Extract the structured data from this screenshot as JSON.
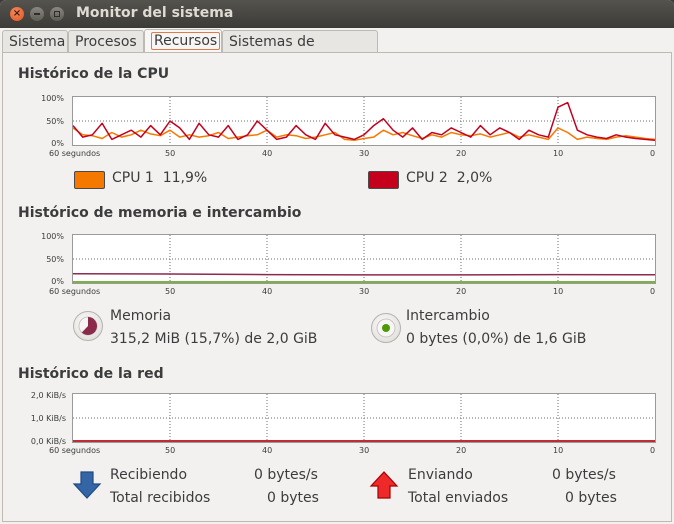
{
  "window": {
    "title": "Monitor del sistema",
    "buttons": {
      "close": "×"
    }
  },
  "tabs": [
    {
      "label": "Sistema",
      "active": false
    },
    {
      "label": "Procesos",
      "active": false
    },
    {
      "label": "Recursos",
      "active": true
    },
    {
      "label": "Sistemas de archivos",
      "active": false
    }
  ],
  "cpu": {
    "title": "Histórico de la CPU",
    "y_ticks": [
      "100%",
      "50%",
      "0%"
    ],
    "x_ticks": [
      "60 segundos",
      "50",
      "40",
      "30",
      "20",
      "10",
      "0"
    ],
    "legend": [
      {
        "label": "CPU 1",
        "value": "11,9%",
        "color": "#f57900"
      },
      {
        "label": "CPU 2",
        "value": "2,0%",
        "color": "#c4001d"
      }
    ]
  },
  "memory": {
    "title": "Histórico de memoria e intercambio",
    "y_ticks": [
      "100%",
      "50%",
      "0%"
    ],
    "x_ticks": [
      "60 segundos",
      "50",
      "40",
      "30",
      "20",
      "10",
      "0"
    ],
    "mem_label": "Memoria",
    "mem_value": "315,2 MiB (15,7%) de 2,0 GiB",
    "mem_color": "#8c2a4c",
    "swap_label": "Intercambio",
    "swap_value": "0 bytes (0,0%) de 1,6 GiB",
    "swap_color": "#4e9a06"
  },
  "network": {
    "title": "Histórico de la red",
    "y_ticks": [
      "2,0 KiB/s",
      "1,0 KiB/s",
      "0,0 KiB/s"
    ],
    "x_ticks": [
      "60 segundos",
      "50",
      "40",
      "30",
      "20",
      "10",
      "0"
    ],
    "recv_label": "Recibiendo",
    "recv_value": "0 bytes/s",
    "recv_total_label": "Total recibidos",
    "recv_total_value": "0 bytes",
    "send_label": "Enviando",
    "send_value": "0 bytes/s",
    "send_total_label": "Total enviados",
    "send_total_value": "0 bytes",
    "recv_color": "#3465a4",
    "send_color": "#cc0000"
  },
  "chart_data": [
    {
      "type": "line",
      "title": "Histórico de la CPU",
      "x": [
        60,
        59,
        58,
        57,
        56,
        55,
        54,
        53,
        52,
        51,
        50,
        49,
        48,
        47,
        46,
        45,
        44,
        43,
        42,
        41,
        40,
        39,
        38,
        37,
        36,
        35,
        34,
        33,
        32,
        31,
        30,
        29,
        28,
        27,
        26,
        25,
        24,
        23,
        22,
        21,
        20,
        19,
        18,
        17,
        16,
        15,
        14,
        13,
        12,
        11,
        10,
        9,
        8,
        7,
        6,
        5,
        4,
        3,
        2,
        1,
        0
      ],
      "ylim": [
        0,
        100
      ],
      "series": [
        {
          "name": "CPU 1",
          "values": [
            35,
            20,
            18,
            12,
            25,
            15,
            20,
            30,
            22,
            18,
            30,
            15,
            20,
            15,
            18,
            25,
            12,
            15,
            18,
            20,
            30,
            15,
            20,
            18,
            12,
            15,
            20,
            25,
            10,
            8,
            12,
            15,
            30,
            20,
            25,
            18,
            12,
            20,
            15,
            25,
            20,
            18,
            22,
            15,
            20,
            25,
            15,
            20,
            15,
            10,
            35,
            25,
            10,
            15,
            12,
            10,
            15,
            18,
            15,
            12,
            10
          ]
        },
        {
          "name": "CPU 2",
          "values": [
            40,
            15,
            20,
            45,
            10,
            20,
            30,
            15,
            40,
            20,
            50,
            35,
            10,
            45,
            20,
            15,
            40,
            10,
            20,
            50,
            30,
            10,
            15,
            40,
            20,
            10,
            45,
            20,
            15,
            10,
            20,
            40,
            55,
            30,
            15,
            35,
            10,
            25,
            20,
            35,
            25,
            15,
            40,
            20,
            35,
            25,
            10,
            30,
            20,
            15,
            80,
            90,
            30,
            20,
            15,
            12,
            20,
            15,
            12,
            10,
            8
          ]
        }
      ]
    },
    {
      "type": "line",
      "title": "Histórico de memoria e intercambio",
      "x": [
        60,
        50,
        40,
        30,
        20,
        10,
        0
      ],
      "ylim": [
        0,
        100
      ],
      "series": [
        {
          "name": "Memoria",
          "values": [
            18,
            17.5,
            16,
            15.5,
            15.5,
            16,
            15.7
          ]
        },
        {
          "name": "Intercambio",
          "values": [
            0,
            0,
            0,
            0,
            0,
            0,
            0
          ]
        }
      ]
    },
    {
      "type": "line",
      "title": "Histórico de la red",
      "x": [
        60,
        50,
        40,
        30,
        20,
        10,
        0
      ],
      "ylim": [
        0,
        2.0
      ],
      "series": [
        {
          "name": "Recibiendo",
          "values": [
            0,
            0,
            0,
            0,
            0,
            0,
            0
          ]
        },
        {
          "name": "Enviando",
          "values": [
            0,
            0,
            0,
            0,
            0,
            0,
            0
          ]
        }
      ]
    }
  ]
}
